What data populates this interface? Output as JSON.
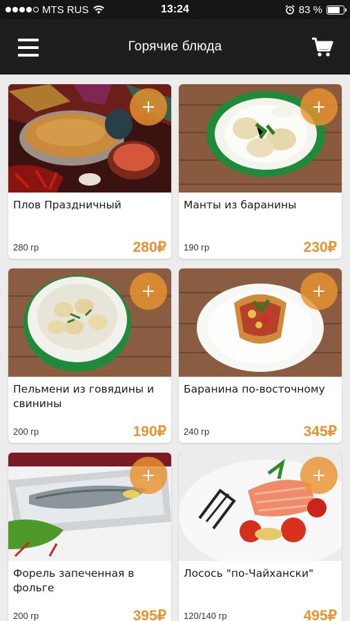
{
  "status_bar": {
    "carrier": "MTS RUS",
    "time": "13:24",
    "battery": "83 %",
    "battery_level": 0.83,
    "signal_bars": 4
  },
  "header": {
    "title": "Горячие блюда",
    "menu_icon": "hamburger-menu-icon",
    "cart_icon": "cart-icon"
  },
  "accent_color": "#e9922f",
  "products": [
    {
      "name": "Плов Праздничный",
      "weight": "280 гр",
      "price": "280₽"
    },
    {
      "name": "Манты из баранины",
      "weight": "190 гр",
      "price": "230₽"
    },
    {
      "name": "Пельмени из говядины и свинины",
      "weight": "200 гр",
      "price": "190₽"
    },
    {
      "name": "Баранина по-восточному",
      "weight": "240 гр",
      "price": "345₽"
    },
    {
      "name": "Форель запеченная в фольге",
      "weight": "200 гр",
      "price": "395₽"
    },
    {
      "name": "Лосось \"по-Чайхански\"",
      "weight": "120/140 гр",
      "price": "495₽"
    }
  ]
}
